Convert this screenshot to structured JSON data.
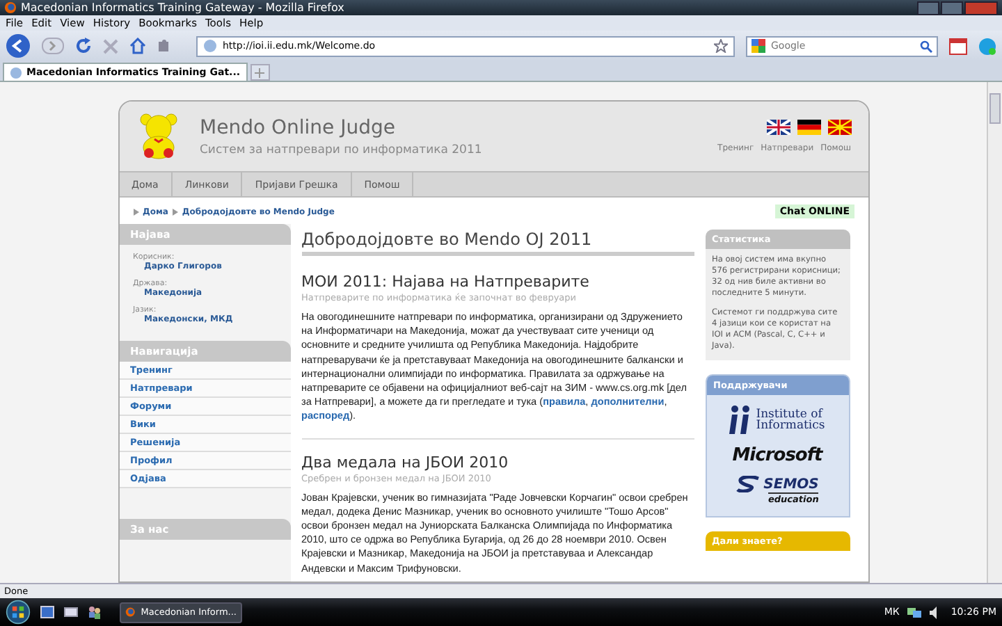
{
  "window": {
    "title": "Macedonian Informatics Training Gateway - Mozilla Firefox"
  },
  "menu": [
    "File",
    "Edit",
    "View",
    "History",
    "Bookmarks",
    "Tools",
    "Help"
  ],
  "address": {
    "value": "http://ioi.ii.edu.mk/Welcome.do"
  },
  "search": {
    "placeholder": "Google"
  },
  "tabs": [
    {
      "label": "Macedonian Informatics Training Gat...",
      "selected": true
    }
  ],
  "site": {
    "title": "Mendo Online Judge",
    "subtitle": "Систем за натпревари по информатика 2011",
    "top_links": [
      "Тренинг",
      "Натпревари",
      "Помош"
    ],
    "nav": [
      "Дома",
      "Линкови",
      "Пријави Грешка",
      "Помош"
    ],
    "breadcrumb": [
      "Дома",
      "Добродојдовте во Mendo Judge"
    ],
    "chat": "Chat ONLINE"
  },
  "sidebar": {
    "login_title": "Најава",
    "fields": [
      {
        "label": "Корисник:",
        "value": "Дарко Глигоров"
      },
      {
        "label": "Држава:",
        "value": "Македонија"
      },
      {
        "label": "Јазик:",
        "value": "Македонски, МКД"
      }
    ],
    "nav_title": "Навигација",
    "items": [
      "Тренинг",
      "Натпревари",
      "Форуми",
      "Вики",
      "Решенија",
      "Профил",
      "Одјава"
    ],
    "about_title": "За нас"
  },
  "main": {
    "heading": "Добродојдовте во Mendo OJ 2011",
    "articles": [
      {
        "title": "МОИ 2011: Најава на Натпреварите",
        "subtitle": "Натпреварите по информатика ќе започнат во февруари",
        "body": [
          {
            "kind": "text",
            "text": "На овогодинешните натпревари по информатика, организирани од Здружението на Информатичари на Македонија, можат да учествуваат сите ученици од основните и средните училишта од Република Македонија. Најдобрите натпреварувачи ќе ја претставуваат Македонија на овогодинешните балкански и интернационални олимпијади по информатика. Правилата за одржување на натпреварите се објавени на официјалниот веб-сајт на ЗИМ - www.cs.org.mk [дел за Натпревари], а можете да ги прегледате и тука ("
          },
          {
            "kind": "link",
            "text": "правила"
          },
          {
            "kind": "text",
            "text": ", "
          },
          {
            "kind": "link",
            "text": "дополнителни"
          },
          {
            "kind": "text",
            "text": ", "
          },
          {
            "kind": "link",
            "text": "распоред"
          },
          {
            "kind": "text",
            "text": ")."
          }
        ]
      },
      {
        "title": "Два медала на ЈБОИ 2010",
        "subtitle": "Сребрен и бронзен медал на ЈБОИ 2010",
        "body": [
          {
            "kind": "text",
            "text": "Јован Крајевски, ученик во гимназијата \"Раде Јовчевски Корчагин\" освои сребрен медал, додека Денис Мазникар, ученик во основното училиште \"Тошо Арсов\" освои бронзен медал на Јуниорската Балканска Олимпијада по Информатика 2010, што се одржа во Република Бугарија, од 26 до 28 ноември 2010. Освен Крајевски и Мазникар, Македонија на ЈБОИ ја претставуваа и Александар Андевски и Максим Трифуновски."
          }
        ]
      }
    ]
  },
  "right": {
    "stats_title": "Статистика",
    "stats": [
      "На овој систем има вкупно 576 регистрирани корисници; 32 од нив биле активни во последните 5 минути.",
      "Системот ги поддржува сите 4 јазици кои се користат на IOI и ACM (Pascal, C, C++ и Java)."
    ],
    "sponsors_title": "Поддржувачи",
    "sponsors": [
      {
        "kind": "institute",
        "line1": "Institute of",
        "line2": "Informatics"
      },
      {
        "kind": "microsoft",
        "line1": "Microsoft"
      },
      {
        "kind": "semos",
        "line1": "SEMOS",
        "line2": "education"
      }
    ],
    "tip_title": "Дали знаете?"
  },
  "status_bar": "Done",
  "taskbar": {
    "task": "Macedonian Inform...",
    "lang": "МК",
    "time": "10:26 PM"
  }
}
